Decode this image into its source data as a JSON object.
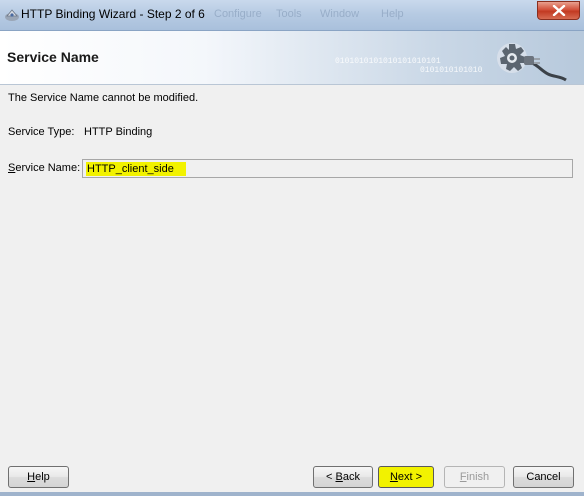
{
  "window": {
    "title": "HTTP Binding Wizard - Step 2 of 6",
    "background_menu_ghost": [
      "Configure",
      "Tools",
      "Window",
      "Help"
    ]
  },
  "header": {
    "title": "Service Name",
    "binary_text": "0101010101010101010101",
    "binary_text_2": "0101010101010",
    "icon": "gear-plug-icon"
  },
  "content": {
    "info_text": "The Service Name cannot be modified.",
    "service_type_label": "Service Type:",
    "service_type_value": "HTTP Binding",
    "service_name_label_prefix": "S",
    "service_name_label_rest": "ervice Name:",
    "service_name_value": "HTTP_client_side"
  },
  "buttons": {
    "help_u": "H",
    "help_rest": "elp",
    "back_prefix": "< ",
    "back_u": "B",
    "back_rest": "ack",
    "next_u": "N",
    "next_rest": "ext >",
    "finish_u": "F",
    "finish_rest": "inish",
    "cancel": "Cancel"
  },
  "colors": {
    "highlight": "#f2f200",
    "close_button": "#c23a22"
  }
}
